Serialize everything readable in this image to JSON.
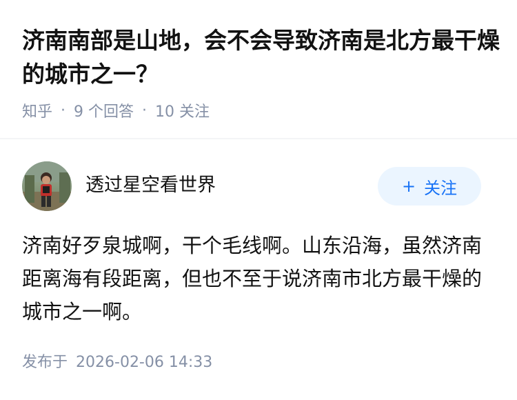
{
  "question": {
    "title": "济南南部是山地，会不会导致济南是北方最干燥的城市之一？",
    "source": "知乎",
    "separator": "·",
    "answer_count": "9 个回答",
    "follower_count": "10 关注"
  },
  "answer": {
    "author_name": "透过星空看世界",
    "follow_label": "关注",
    "follow_icon": "+",
    "content": "济南好歹泉城啊，干个毛线啊。山东沿海，虽然济南距离海有段距离，但也不至于说济南市北方最干燥的城市之一啊。",
    "publish_label": "发布于",
    "publish_time": "2026-02-06 14:33"
  },
  "colors": {
    "text_primary": "#121212",
    "text_secondary": "#8590a6",
    "accent": "#1772f6",
    "button_bg": "#ebf5ff"
  }
}
